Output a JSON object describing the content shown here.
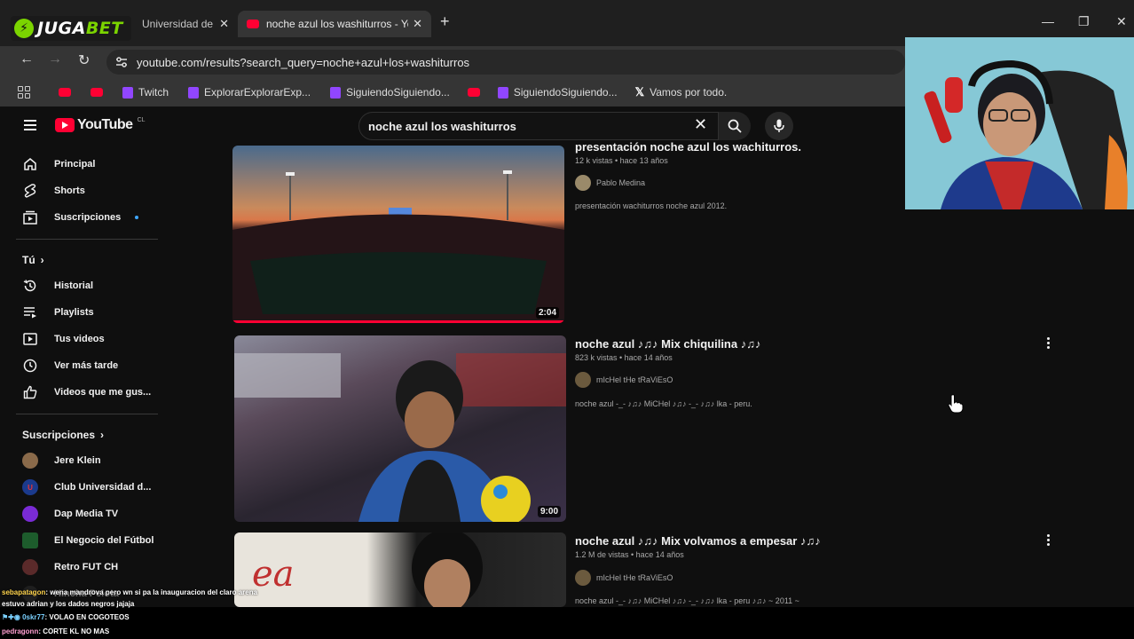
{
  "browser": {
    "brand_logo": "JUGABET",
    "tabs": [
      {
        "label": "Universidad de"
      },
      {
        "label": "noche azul los washiturros - You"
      }
    ],
    "url": "youtube.com/results?search_query=noche+azul+los+washiturros",
    "bookmarks": [
      {
        "type": "youtube",
        "label": ""
      },
      {
        "type": "youtube",
        "label": ""
      },
      {
        "type": "twitch",
        "label": "Twitch"
      },
      {
        "type": "twitch",
        "label": "ExplorarExplorarExp..."
      },
      {
        "type": "twitch",
        "label": "SiguiendoSiguiendo..."
      },
      {
        "type": "youtube",
        "label": ""
      },
      {
        "type": "twitch",
        "label": "SiguiendoSiguiendo..."
      },
      {
        "type": "x",
        "label": "Vamos por todo."
      }
    ]
  },
  "youtube": {
    "logo": "YouTube",
    "country": "CL",
    "search_query": "noche azul los washiturros",
    "sidebar": {
      "main": [
        {
          "icon": "home-icon",
          "label": "Principal"
        },
        {
          "icon": "shorts-icon",
          "label": "Shorts"
        },
        {
          "icon": "subscriptions-icon",
          "label": "Suscripciones"
        }
      ],
      "you_heading": "Tú",
      "you": [
        {
          "icon": "history-icon",
          "label": "Historial"
        },
        {
          "icon": "playlists-icon",
          "label": "Playlists"
        },
        {
          "icon": "your-videos-icon",
          "label": "Tus videos"
        },
        {
          "icon": "watch-later-icon",
          "label": "Ver más tarde"
        },
        {
          "icon": "liked-icon",
          "label": "Videos que me gus..."
        }
      ],
      "subs_heading": "Suscripciones",
      "subs": [
        {
          "label": "Jere Klein",
          "color": "#8a6a4a"
        },
        {
          "label": "Club Universidad d...",
          "color": "#1b3a8c"
        },
        {
          "label": "Dap Media TV",
          "color": "#7a2bd6"
        },
        {
          "label": "El Negocio del Fútbol",
          "color": "#1d5c2c"
        },
        {
          "label": "Retro FUT CH",
          "color": "#5a2a2a"
        },
        {
          "label": "Hincha Pelota",
          "color": "#333333"
        }
      ]
    },
    "results": [
      {
        "title": "presentación noche azul los wachiturros.",
        "meta": "12 k vistas • hace 13 años",
        "channel": "Pablo Medina",
        "description": "presentación wachiturros noche azul 2012.",
        "duration": "2:04",
        "progress": 1.0
      },
      {
        "title": "noche azul ♪♫♪ Mix chiquilina ♪♫♪",
        "meta": "823 k vistas • hace 14 años",
        "channel": "mIcHel tHe tRaViEsO",
        "description": "noche azul -_- ♪♫♪ MiCHel ♪♫♪ -_- ♪♫♪ lka - peru.",
        "duration": "9:00"
      },
      {
        "title": "noche azul ♪♫♪ Mix volvamos a empesar ♪♫♪",
        "meta": "1.2 M de vistas • hace 14 años",
        "channel": "mIcHel tHe tRaViEsO",
        "description": "noche azul -_- ♪♫♪ MiCHel ♪♫♪ -_- ♪♫♪ lka - peru ♪♫♪ ~ 2011 ~"
      }
    ]
  },
  "chat": [
    {
      "user": "sebapatagon",
      "text": ": wena mandrova pero wn si pa la inauguracion del claro arena"
    },
    {
      "user": "",
      "text": "estuvo adrian y los dados negros jajaja"
    },
    {
      "user": "0skr77",
      "text": ": VOLAO EN COGOTEOS"
    },
    {
      "user": "pedragonn",
      "text": ": CORTE KL NO MAS"
    }
  ]
}
